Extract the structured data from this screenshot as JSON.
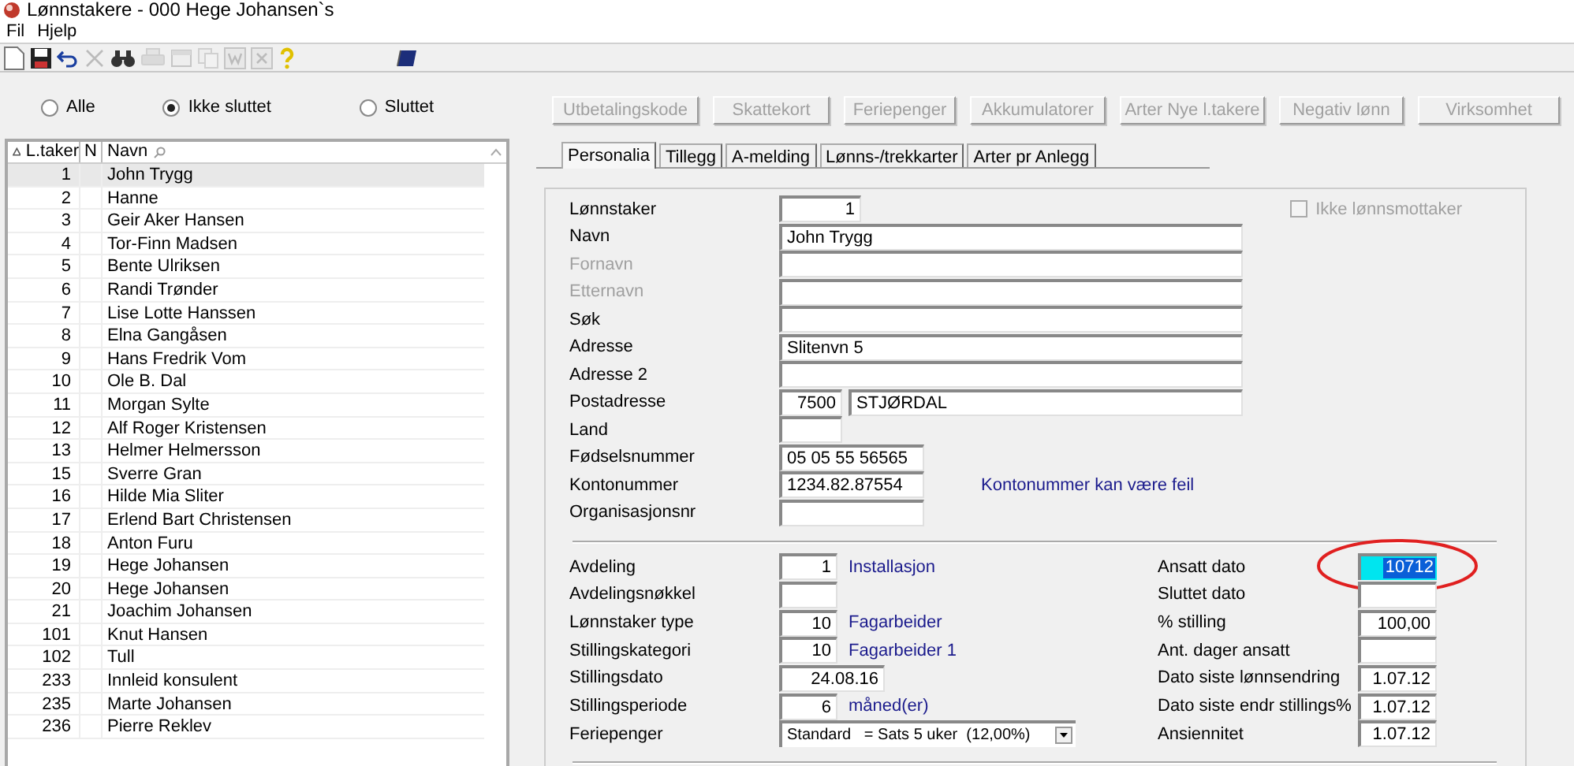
{
  "window": {
    "title": "Lønnstakere - 000 Hege Johansen`s"
  },
  "menu": [
    "Fil",
    "Hjelp"
  ],
  "toolbar": [
    {
      "kind": "new",
      "disabled": false
    },
    {
      "kind": "save",
      "disabled": false
    },
    {
      "kind": "undo",
      "disabled": false
    },
    {
      "kind": "delete",
      "disabled": true
    },
    {
      "kind": "find",
      "disabled": false
    },
    {
      "kind": "print",
      "disabled": true
    },
    {
      "kind": "window",
      "disabled": true
    },
    {
      "kind": "copy",
      "disabled": true
    },
    {
      "kind": "word",
      "disabled": true
    },
    {
      "kind": "excel",
      "disabled": true
    },
    {
      "kind": "help",
      "disabled": false
    },
    {
      "kind": "book",
      "disabled": false
    }
  ],
  "filter": [
    {
      "label": "Alle",
      "selected": false
    },
    {
      "label": "Ikke sluttet",
      "selected": true
    },
    {
      "label": "Sluttet",
      "selected": false
    }
  ],
  "table": {
    "columns": [
      "L.taker",
      "N",
      "Navn"
    ],
    "rows": [
      {
        "id": "1",
        "name": "John Trygg",
        "selected": true
      },
      {
        "id": "2",
        "name": "Hanne",
        "selected": false
      },
      {
        "id": "3",
        "name": "Geir Aker Hansen",
        "selected": false
      },
      {
        "id": "4",
        "name": "Tor-Finn Madsen",
        "selected": false
      },
      {
        "id": "5",
        "name": "Bente Ulriksen",
        "selected": false
      },
      {
        "id": "6",
        "name": "Randi Trønder",
        "selected": false
      },
      {
        "id": "7",
        "name": "Lise Lotte Hanssen",
        "selected": false
      },
      {
        "id": "8",
        "name": "Elna Gangåsen",
        "selected": false
      },
      {
        "id": "9",
        "name": "Hans Fredrik Vom",
        "selected": false
      },
      {
        "id": "10",
        "name": "Ole B. Dal",
        "selected": false
      },
      {
        "id": "11",
        "name": "Morgan Sylte",
        "selected": false
      },
      {
        "id": "12",
        "name": "Alf Roger Kristensen",
        "selected": false
      },
      {
        "id": "13",
        "name": "Helmer Helmersson",
        "selected": false
      },
      {
        "id": "15",
        "name": "Sverre Gran",
        "selected": false
      },
      {
        "id": "16",
        "name": "Hilde Mia Sliter",
        "selected": false
      },
      {
        "id": "17",
        "name": "Erlend Bart Christensen",
        "selected": false
      },
      {
        "id": "18",
        "name": "Anton Furu",
        "selected": false
      },
      {
        "id": "19",
        "name": "Hege Johansen",
        "selected": false
      },
      {
        "id": "20",
        "name": "Hege Johansen",
        "selected": false
      },
      {
        "id": "21",
        "name": "Joachim Johansen",
        "selected": false
      },
      {
        "id": "101",
        "name": "Knut Hansen",
        "selected": false
      },
      {
        "id": "102",
        "name": "Tull",
        "selected": false
      },
      {
        "id": "233",
        "name": "Innleid konsulent",
        "selected": false
      },
      {
        "id": "235",
        "name": "Marte Johansen",
        "selected": false
      },
      {
        "id": "236",
        "name": "Pierre Reklev",
        "selected": false
      }
    ]
  },
  "buttons": [
    {
      "label": "Utbetalingskode",
      "disabled": true
    },
    {
      "label": "Skattekort",
      "disabled": true
    },
    {
      "label": "Feriepenger",
      "disabled": true
    },
    {
      "label": "Akkumulatorer",
      "disabled": true
    },
    {
      "label": "Arter Nye l.takere",
      "disabled": true
    },
    {
      "label": "Negativ lønn",
      "disabled": true
    },
    {
      "label": "Virksomhet",
      "disabled": true
    }
  ],
  "tabs": [
    {
      "label": "Personalia",
      "selected": true
    },
    {
      "label": "Tillegg",
      "selected": false
    },
    {
      "label": "A-melding",
      "selected": false
    },
    {
      "label": "Lønns-/trekkarter",
      "selected": false
    },
    {
      "label": "Arter pr Anlegg",
      "selected": false
    }
  ],
  "ikke_lonnsmottaker": {
    "label": "Ikke lønnsmottaker",
    "checked": false,
    "disabled": true
  },
  "personal_fields": [
    {
      "label": "Lønnstaker",
      "disabled": false,
      "inputs": [
        {
          "kind": "number",
          "value": "1"
        }
      ]
    },
    {
      "label": "Navn",
      "disabled": false,
      "inputs": [
        {
          "kind": "text",
          "value": "John Trygg"
        }
      ]
    },
    {
      "label": "Fornavn",
      "disabled": true,
      "inputs": [
        {
          "kind": "text"
        }
      ]
    },
    {
      "label": "Etternavn",
      "disabled": true,
      "inputs": [
        {
          "kind": "text"
        }
      ]
    },
    {
      "label": "Søk",
      "disabled": false,
      "inputs": [
        {
          "kind": "text"
        }
      ]
    },
    {
      "label": "Adresse",
      "disabled": false,
      "inputs": [
        {
          "kind": "text",
          "value": "Slitenvn 5"
        }
      ]
    },
    {
      "label": "Adresse 2",
      "disabled": false,
      "inputs": [
        {
          "kind": "text"
        }
      ]
    },
    {
      "label": "Postadresse",
      "disabled": false,
      "inputs": [
        {
          "kind": "number",
          "value": "7500"
        },
        {
          "kind": "text",
          "value": "STJØRDAL"
        }
      ]
    },
    {
      "label": "Land",
      "disabled": false,
      "inputs": [
        {
          "kind": "text"
        }
      ]
    },
    {
      "label": "Fødselsnummer",
      "disabled": false,
      "inputs": [
        {
          "kind": "text",
          "value": "05 05 55 56565"
        }
      ]
    },
    {
      "label": "Kontonummer",
      "disabled": false,
      "inputs": [
        {
          "kind": "text",
          "value": "1234.82.87554"
        }
      ],
      "note": "Kontonummer kan være feil"
    },
    {
      "label": "Organisasjonsnr",
      "disabled": false,
      "inputs": [
        {
          "kind": "text"
        }
      ]
    }
  ],
  "employment_fields": [
    {
      "label": "Avdeling",
      "value": "1",
      "description": "Installasjon"
    },
    {
      "label": "Avdelingsnøkkel"
    },
    {
      "label": "Lønnstaker type",
      "value": "10",
      "description": "Fagarbeider"
    },
    {
      "label": "Stillingskategori",
      "value": "10",
      "description": "Fagarbeider 1"
    },
    {
      "label": "Stillingsdato",
      "value": "24.08.16"
    },
    {
      "label": "Stillingsperiode",
      "value": "6",
      "description": "måned(er)"
    },
    {
      "label": "Feriepenger",
      "kind": "dropdown",
      "value": "Standard   = Sats 5 uker  (12,00%)"
    }
  ],
  "date_fields": [
    {
      "label": "Ansatt dato",
      "value": "10712",
      "focused": true
    },
    {
      "label": "Sluttet dato",
      "focused": false
    },
    {
      "label": "% stilling",
      "value": "100,00",
      "focused": false
    },
    {
      "label": "Ant. dager ansatt",
      "focused": false
    },
    {
      "label": "Dato siste lønnsendring",
      "value": "1.07.12",
      "focused": false
    },
    {
      "label": "Dato siste endr stillings%",
      "value": "1.07.12",
      "focused": false
    },
    {
      "label": "Ansiennitet",
      "value": "1.07.12",
      "focused": false
    }
  ]
}
